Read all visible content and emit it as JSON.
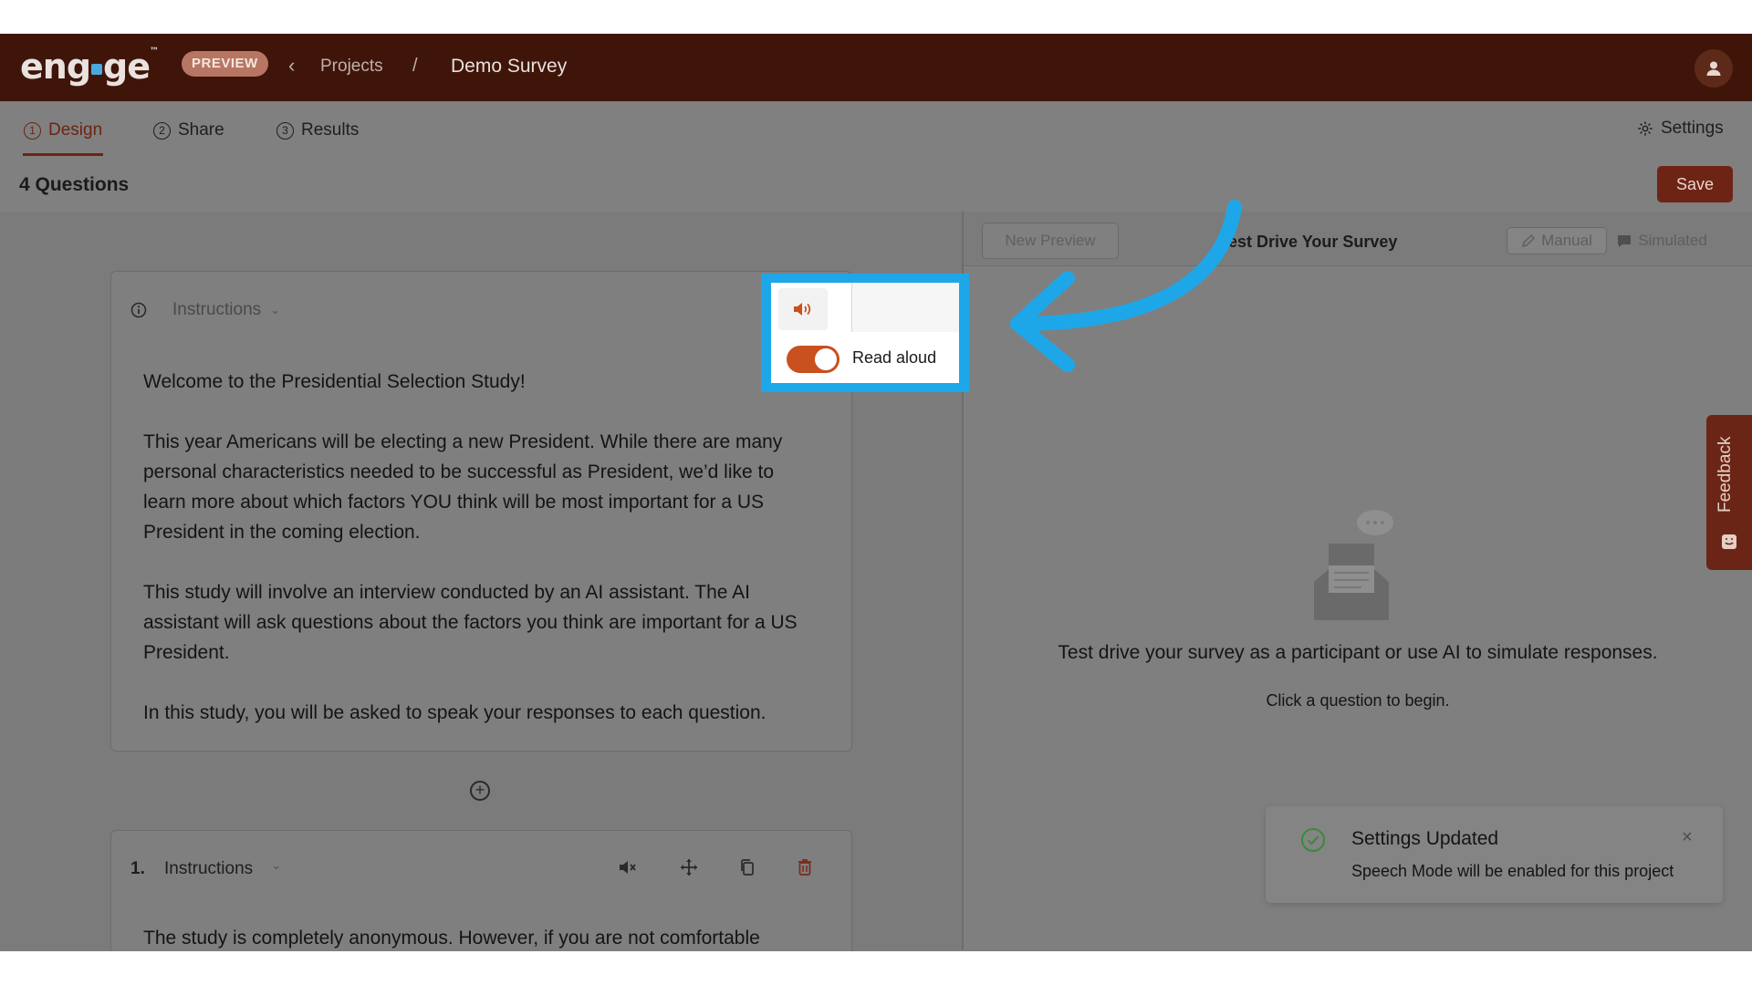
{
  "app": {
    "logo_text": "engage",
    "badge": "PREVIEW",
    "breadcrumb": {
      "parent": "Projects",
      "separator": "/",
      "current": "Demo Survey"
    }
  },
  "tabs": [
    {
      "number": "1",
      "label": "Design",
      "active": true
    },
    {
      "number": "2",
      "label": "Share",
      "active": false
    },
    {
      "number": "3",
      "label": "Results",
      "active": false
    }
  ],
  "settings_label": "Settings",
  "question_count": "4 Questions",
  "save_label": "Save",
  "intro_card": {
    "type_label": "Instructions",
    "paragraphs": [
      "Welcome to the Presidential Selection Study!",
      "This year Americans will be electing a new President. While there are many personal characteristics needed to be successful as President, we’d like to learn more about which factors YOU think will be most important for a US President in the coming election.",
      "This study will involve an interview conducted by an AI assistant. The AI assistant will ask questions about the factors you think are important for a US President.",
      "In this study, you will be asked to speak your responses to each question."
    ]
  },
  "question_1": {
    "number": "1.",
    "type_label": "Instructions",
    "text": "The study is completely anonymous. However, if you are not comfortable"
  },
  "popup": {
    "read_aloud_label": "Read aloud",
    "read_aloud_on": true
  },
  "preview": {
    "new_preview_label": "New Preview",
    "title": "est Drive Your Survey",
    "modes": {
      "manual": "Manual",
      "simulated": "Simulated"
    },
    "empty_title": "Test drive your survey as a participant or use AI to simulate responses.",
    "empty_subtitle": "Click a question to begin."
  },
  "feedback_label": "Feedback",
  "toast": {
    "title": "Settings Updated",
    "message": "Speech Mode will be enabled for this project",
    "close": "×"
  },
  "colors": {
    "brand_dark": "#3f150a",
    "accent": "#6e2415",
    "toggle_on": "#c9501f",
    "highlight": "#1ea7e8",
    "success": "#3a8a3a"
  }
}
